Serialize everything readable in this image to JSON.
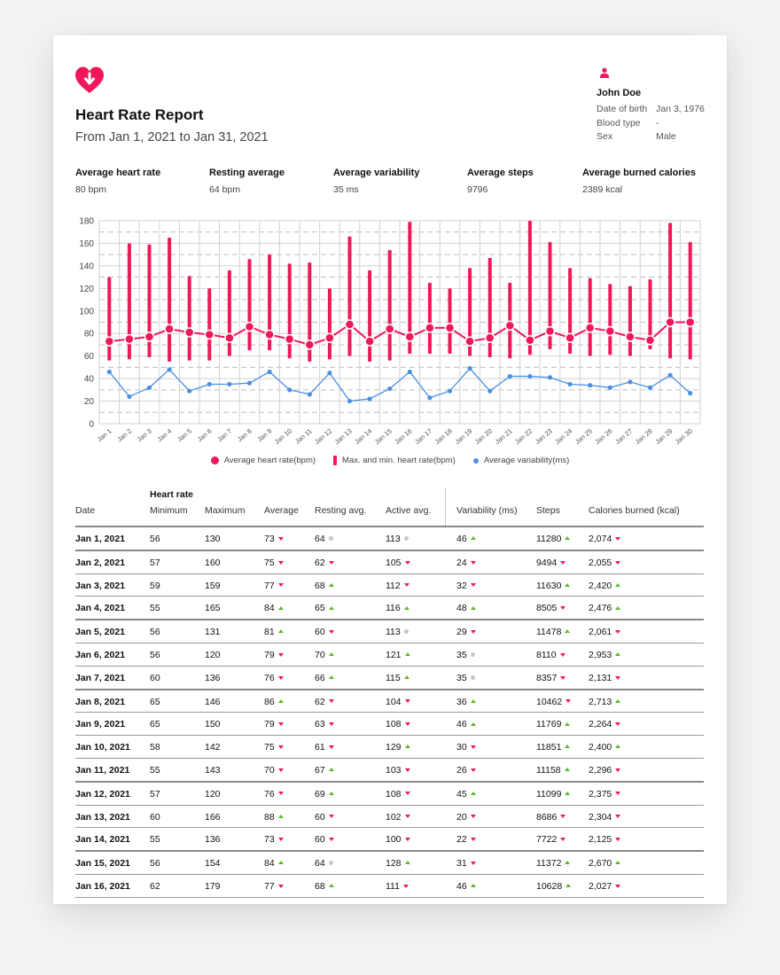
{
  "report": {
    "title": "Heart Rate Report",
    "subtitle": "From Jan 1, 2021 to Jan 31, 2021"
  },
  "person": {
    "name": "John Doe",
    "dob_label": "Date of birth",
    "dob_value": "Jan 3, 1976",
    "blood_label": "Blood type",
    "blood_value": "-",
    "sex_label": "Sex",
    "sex_value": "Male"
  },
  "stats": [
    {
      "label": "Average heart rate",
      "value": "80 bpm"
    },
    {
      "label": "Resting average",
      "value": "64 bpm"
    },
    {
      "label": "Average variability",
      "value": "35 ms"
    },
    {
      "label": "Average steps",
      "value": "9796"
    },
    {
      "label": "Average burned calories",
      "value": "2389 kcal"
    }
  ],
  "colors": {
    "accent": "#f0185a",
    "variability": "#4a90e2",
    "up": "#5cb82a",
    "neutral": "#c6c6c6"
  },
  "icons": {
    "logo": "heart-arrow-down-icon",
    "person": "person-icon"
  },
  "chart_data": {
    "type": "line",
    "categories": [
      "Jan 1",
      "Jan 2",
      "Jan 3",
      "Jan 4",
      "Jan 5",
      "Jan 6",
      "Jan 7",
      "Jan 8",
      "Jan 9",
      "Jan 10",
      "Jan 11",
      "Jan 12",
      "Jan 13",
      "Jan 14",
      "Jan 15",
      "Jan 16",
      "Jan 17",
      "Jan 18",
      "Jan 19",
      "Jan 20",
      "Jan 21",
      "Jan 22",
      "Jan 23",
      "Jan 24",
      "Jan 25",
      "Jan 26",
      "Jan 27",
      "Jan 28",
      "Jan 29",
      "Jan 30"
    ],
    "ylim": [
      0,
      180
    ],
    "yticks": [
      0,
      20,
      40,
      60,
      80,
      100,
      120,
      140,
      160,
      180
    ],
    "grid": true,
    "legend_position": "bottom",
    "series": [
      {
        "name": "Average heart rate(bpm)",
        "kind": "line-marker",
        "values": [
          73,
          75,
          77,
          84,
          81,
          79,
          76,
          86,
          79,
          75,
          70,
          76,
          88,
          73,
          84,
          77,
          85,
          85,
          73,
          76,
          87,
          74,
          82,
          76,
          85,
          82,
          77,
          74,
          90,
          90
        ]
      },
      {
        "name": "Max. and min. heart rate(bpm)",
        "kind": "range-bar",
        "min": [
          56,
          57,
          59,
          55,
          56,
          56,
          60,
          65,
          65,
          58,
          55,
          57,
          60,
          55,
          56,
          62,
          62,
          62,
          60,
          59,
          58,
          61,
          66,
          62,
          60,
          61,
          60,
          66,
          58,
          57
        ],
        "max": [
          130,
          160,
          159,
          165,
          131,
          120,
          136,
          146,
          150,
          142,
          143,
          120,
          166,
          136,
          154,
          179,
          125,
          120,
          138,
          147,
          125,
          180,
          161,
          138,
          129,
          124,
          122,
          128,
          178,
          161
        ]
      },
      {
        "name": "Average variability(ms)",
        "kind": "line-dot",
        "values": [
          46,
          24,
          32,
          48,
          29,
          35,
          35,
          36,
          46,
          30,
          26,
          45,
          20,
          22,
          31,
          46,
          23,
          29,
          49,
          29,
          42,
          42,
          41,
          35,
          34,
          32,
          37,
          32,
          43,
          27
        ]
      }
    ]
  },
  "table": {
    "group_label": "Heart rate",
    "headers": [
      "Date",
      "Minimum",
      "Maximum",
      "Average",
      "Resting avg.",
      "Active avg.",
      "Variability (ms)",
      "Steps",
      "Calories burned (kcal)"
    ],
    "rows": [
      {
        "date": "Jan 1, 2021",
        "min": "56",
        "max": "130",
        "avg": "73",
        "avg_t": "down",
        "rest": "64",
        "rest_t": "same",
        "active": "113",
        "active_t": "same",
        "var": "46",
        "var_t": "up",
        "steps": "11280",
        "steps_t": "up",
        "cal": "2,074",
        "cal_t": "down"
      },
      {
        "date": "Jan 2, 2021",
        "min": "57",
        "max": "160",
        "avg": "75",
        "avg_t": "down",
        "rest": "62",
        "rest_t": "down",
        "active": "105",
        "active_t": "down",
        "var": "24",
        "var_t": "down",
        "steps": "9494",
        "steps_t": "down",
        "cal": "2,055",
        "cal_t": "down"
      },
      {
        "date": "Jan 3, 2021",
        "min": "59",
        "max": "159",
        "avg": "77",
        "avg_t": "down",
        "rest": "68",
        "rest_t": "up",
        "active": "112",
        "active_t": "down",
        "var": "32",
        "var_t": "down",
        "steps": "11630",
        "steps_t": "up",
        "cal": "2,420",
        "cal_t": "up"
      },
      {
        "date": "Jan 4, 2021",
        "min": "55",
        "max": "165",
        "avg": "84",
        "avg_t": "up",
        "rest": "65",
        "rest_t": "up",
        "active": "116",
        "active_t": "up",
        "var": "48",
        "var_t": "up",
        "steps": "8505",
        "steps_t": "down",
        "cal": "2,476",
        "cal_t": "up"
      },
      {
        "date": "Jan 5, 2021",
        "min": "56",
        "max": "131",
        "avg": "81",
        "avg_t": "up",
        "rest": "60",
        "rest_t": "down",
        "active": "113",
        "active_t": "same",
        "var": "29",
        "var_t": "down",
        "steps": "11478",
        "steps_t": "up",
        "cal": "2,061",
        "cal_t": "down"
      },
      {
        "date": "Jan 6, 2021",
        "min": "56",
        "max": "120",
        "avg": "79",
        "avg_t": "down",
        "rest": "70",
        "rest_t": "up",
        "active": "121",
        "active_t": "up",
        "var": "35",
        "var_t": "same",
        "steps": "8110",
        "steps_t": "down",
        "cal": "2,953",
        "cal_t": "up"
      },
      {
        "date": "Jan 7, 2021",
        "min": "60",
        "max": "136",
        "avg": "76",
        "avg_t": "down",
        "rest": "66",
        "rest_t": "up",
        "active": "115",
        "active_t": "up",
        "var": "35",
        "var_t": "same",
        "steps": "8357",
        "steps_t": "down",
        "cal": "2,131",
        "cal_t": "down"
      },
      {
        "date": "Jan 8, 2021",
        "min": "65",
        "max": "146",
        "avg": "86",
        "avg_t": "up",
        "rest": "62",
        "rest_t": "down",
        "active": "104",
        "active_t": "down",
        "var": "36",
        "var_t": "up",
        "steps": "10462",
        "steps_t": "down",
        "cal": "2,713",
        "cal_t": "up"
      },
      {
        "date": "Jan 9, 2021",
        "min": "65",
        "max": "150",
        "avg": "79",
        "avg_t": "down",
        "rest": "63",
        "rest_t": "down",
        "active": "108",
        "active_t": "down",
        "var": "46",
        "var_t": "up",
        "steps": "11769",
        "steps_t": "up",
        "cal": "2,264",
        "cal_t": "down"
      },
      {
        "date": "Jan 10, 2021",
        "min": "58",
        "max": "142",
        "avg": "75",
        "avg_t": "down",
        "rest": "61",
        "rest_t": "down",
        "active": "129",
        "active_t": "up",
        "var": "30",
        "var_t": "down",
        "steps": "11851",
        "steps_t": "up",
        "cal": "2,400",
        "cal_t": "up"
      },
      {
        "date": "Jan 11, 2021",
        "min": "55",
        "max": "143",
        "avg": "70",
        "avg_t": "down",
        "rest": "67",
        "rest_t": "up",
        "active": "103",
        "active_t": "down",
        "var": "26",
        "var_t": "down",
        "steps": "11158",
        "steps_t": "up",
        "cal": "2,296",
        "cal_t": "down"
      },
      {
        "date": "Jan 12, 2021",
        "min": "57",
        "max": "120",
        "avg": "76",
        "avg_t": "down",
        "rest": "69",
        "rest_t": "up",
        "active": "108",
        "active_t": "down",
        "var": "45",
        "var_t": "up",
        "steps": "11099",
        "steps_t": "up",
        "cal": "2,375",
        "cal_t": "down"
      },
      {
        "date": "Jan 13, 2021",
        "min": "60",
        "max": "166",
        "avg": "88",
        "avg_t": "up",
        "rest": "60",
        "rest_t": "down",
        "active": "102",
        "active_t": "down",
        "var": "20",
        "var_t": "down",
        "steps": "8686",
        "steps_t": "down",
        "cal": "2,304",
        "cal_t": "down"
      },
      {
        "date": "Jan 14, 2021",
        "min": "55",
        "max": "136",
        "avg": "73",
        "avg_t": "down",
        "rest": "60",
        "rest_t": "down",
        "active": "100",
        "active_t": "down",
        "var": "22",
        "var_t": "down",
        "steps": "7722",
        "steps_t": "down",
        "cal": "2,125",
        "cal_t": "down"
      },
      {
        "date": "Jan 15, 2021",
        "min": "56",
        "max": "154",
        "avg": "84",
        "avg_t": "up",
        "rest": "64",
        "rest_t": "same",
        "active": "128",
        "active_t": "up",
        "var": "31",
        "var_t": "down",
        "steps": "11372",
        "steps_t": "up",
        "cal": "2,670",
        "cal_t": "up"
      },
      {
        "date": "Jan 16, 2021",
        "min": "62",
        "max": "179",
        "avg": "77",
        "avg_t": "down",
        "rest": "68",
        "rest_t": "up",
        "active": "111",
        "active_t": "down",
        "var": "46",
        "var_t": "up",
        "steps": "10628",
        "steps_t": "up",
        "cal": "2,027",
        "cal_t": "down"
      }
    ]
  }
}
